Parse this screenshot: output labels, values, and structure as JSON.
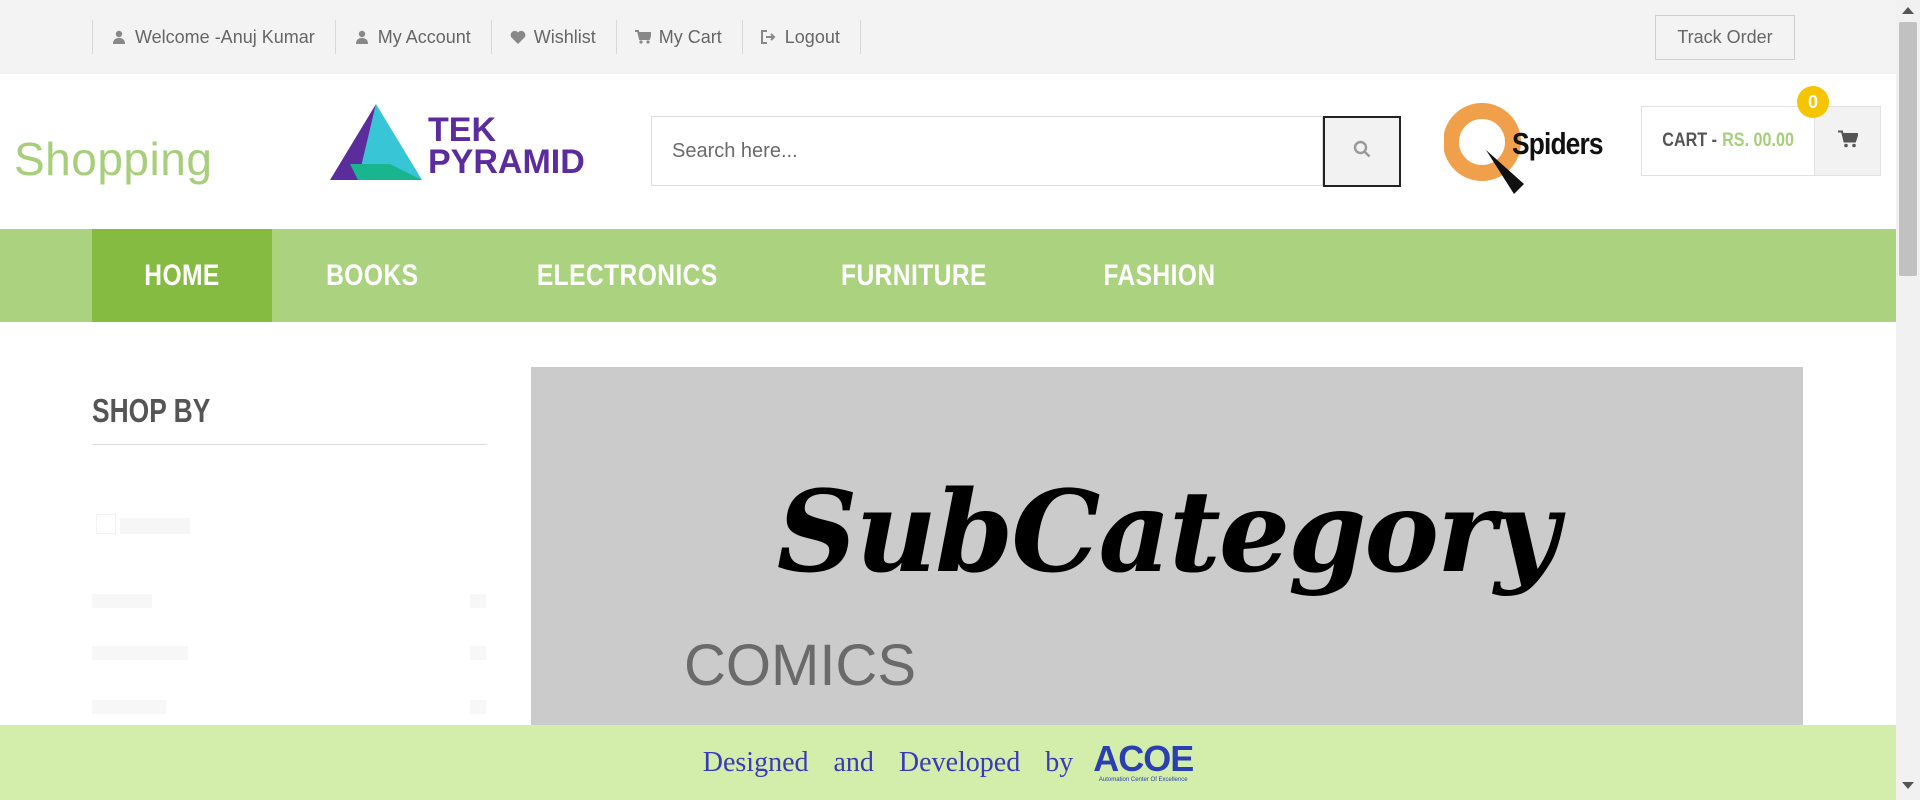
{
  "top_links": [
    {
      "label": "Welcome -Anuj Kumar",
      "icon": "user-icon"
    },
    {
      "label": "My Account",
      "icon": "user-icon"
    },
    {
      "label": "Wishlist",
      "icon": "heart-icon"
    },
    {
      "label": "My Cart",
      "icon": "cart-icon"
    },
    {
      "label": "Logout",
      "icon": "logout-icon"
    }
  ],
  "track_order_label": "Track Order",
  "brand": "Shopping",
  "tek_logo": {
    "line1": "TEK",
    "line2": "PYRAMID"
  },
  "search": {
    "placeholder": "Search here...",
    "icon": "search-icon"
  },
  "qspiders_logo": "Spiders",
  "cart": {
    "label": "CART -",
    "amount": "RS. 00.00",
    "count": "0",
    "icon": "cart-icon"
  },
  "nav": [
    {
      "label": "HOME",
      "active": true
    },
    {
      "label": "BOOKS",
      "active": false
    },
    {
      "label": "ELECTRONICS",
      "active": false
    },
    {
      "label": "FURNITURE",
      "active": false
    },
    {
      "label": "FASHION",
      "active": false
    }
  ],
  "sidebar": {
    "heading": "SHOP BY"
  },
  "banner": {
    "title": "SubCategory",
    "subcategory": "COMICS"
  },
  "footer": {
    "text": "Designed and Developed by",
    "logo": "ACOE",
    "logo_sub": "Automation Center Of Excellence"
  },
  "colors": {
    "brand_green": "#a7cf7b",
    "nav_bg": "#abd27f",
    "nav_active": "#84bb40",
    "footer_bg": "#d3edab",
    "badge": "#f4c500",
    "tek_purple": "#5b2d9c"
  }
}
